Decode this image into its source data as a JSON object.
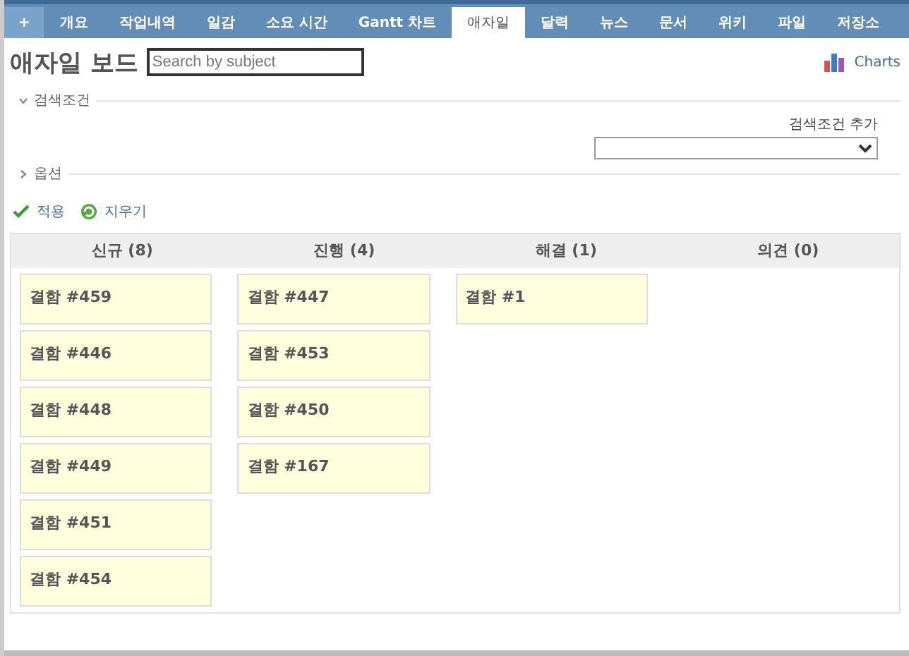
{
  "tabs": [
    {
      "label": "+",
      "selected": false
    },
    {
      "label": "개요",
      "selected": false
    },
    {
      "label": "작업내역",
      "selected": false
    },
    {
      "label": "일감",
      "selected": false
    },
    {
      "label": "소요 시간",
      "selected": false
    },
    {
      "label": "Gantt 차트",
      "selected": false
    },
    {
      "label": "애자일",
      "selected": true
    },
    {
      "label": "달력",
      "selected": false
    },
    {
      "label": "뉴스",
      "selected": false
    },
    {
      "label": "문서",
      "selected": false
    },
    {
      "label": "위키",
      "selected": false
    },
    {
      "label": "파일",
      "selected": false
    },
    {
      "label": "저장소",
      "selected": false
    }
  ],
  "title": "애자일 보드",
  "search": {
    "placeholder": "Search by subject"
  },
  "charts_link": "Charts",
  "filters": {
    "label": "검색조건",
    "expanded": true,
    "add_label": "검색조건 추가"
  },
  "options": {
    "label": "옵션",
    "expanded": false
  },
  "actions": [
    {
      "kind": "apply",
      "label": "적용"
    },
    {
      "kind": "clear",
      "label": "지우기"
    }
  ],
  "columns": [
    {
      "title": "신규 (8)",
      "cards": [
        {
          "label": "결함 #459"
        },
        {
          "label": "결함 #446"
        },
        {
          "label": "결함 #448"
        },
        {
          "label": "결함 #449"
        },
        {
          "label": "결함 #451"
        },
        {
          "label": "결함 #454"
        }
      ]
    },
    {
      "title": "진행 (4)",
      "cards": [
        {
          "label": "결함 #447"
        },
        {
          "label": "결함 #453"
        },
        {
          "label": "결함 #450"
        },
        {
          "label": "결함 #167"
        }
      ]
    },
    {
      "title": "해결 (1)",
      "cards": [
        {
          "label": "결함 #1"
        }
      ]
    },
    {
      "title": "의견 (0)"
    }
  ]
}
